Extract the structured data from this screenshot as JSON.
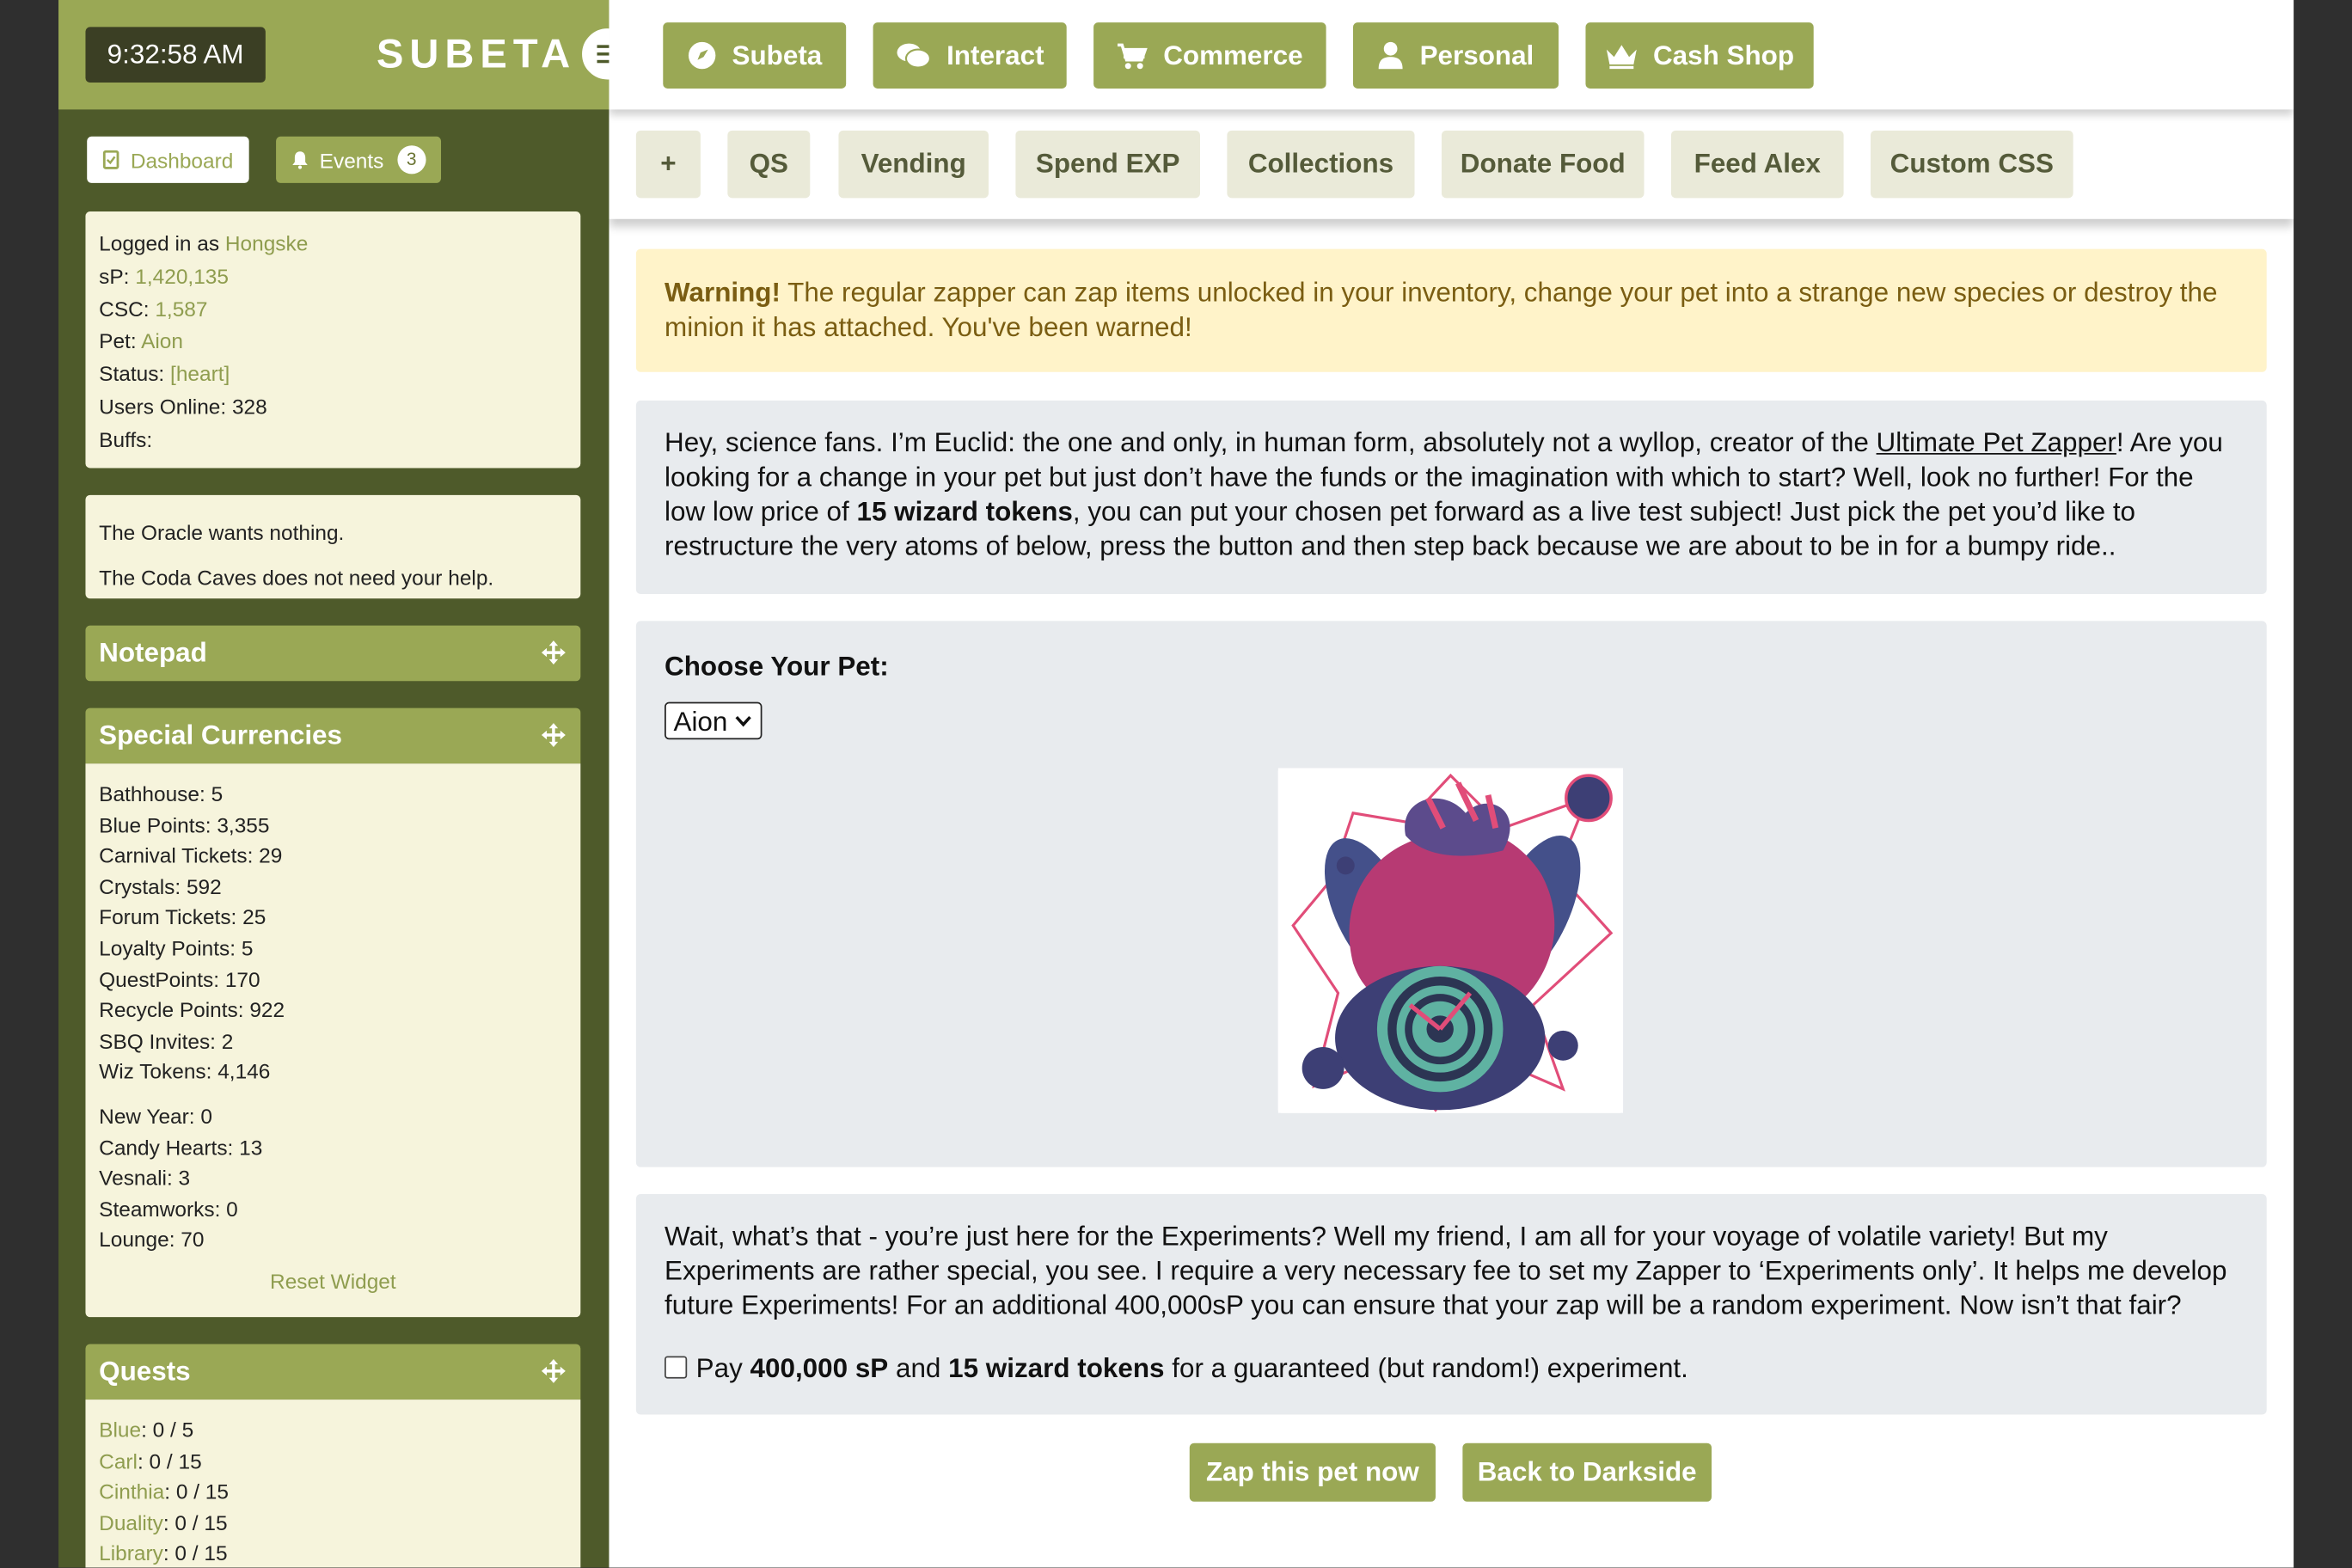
{
  "top": {
    "clock": "9:32:58 AM",
    "logo": "SUBETA",
    "nav": [
      {
        "label": "Subeta",
        "icon": "compass-icon"
      },
      {
        "label": "Interact",
        "icon": "chat-icon"
      },
      {
        "label": "Commerce",
        "icon": "cart-icon"
      },
      {
        "label": "Personal",
        "icon": "user-icon"
      },
      {
        "label": "Cash Shop",
        "icon": "crown-icon"
      }
    ],
    "subnav": [
      "+",
      "QS",
      "Vending",
      "Spend EXP",
      "Collections",
      "Donate Food",
      "Feed Alex",
      "Custom CSS"
    ]
  },
  "sidebar": {
    "dashboard": "Dashboard",
    "events": "Events",
    "events_count": "3",
    "user": {
      "logged_in_label": "Logged in as",
      "username": "Hongske",
      "sp_label": "sP:",
      "sp": "1,420,135",
      "csc_label": "CSC:",
      "csc": "1,587",
      "pet_label": "Pet:",
      "pet": "Aion",
      "status_label": "Status:",
      "status": "[heart]",
      "users_online": "Users Online: 328",
      "buffs": "Buffs:"
    },
    "oracle": [
      "The Oracle wants nothing.",
      "The Coda Caves does not need your help."
    ],
    "notepad_title": "Notepad",
    "currencies_title": "Special Currencies",
    "currencies": [
      "Bathhouse: 5",
      "Blue Points: 3,355",
      "Carnival Tickets: 29",
      "Crystals: 592",
      "Forum Tickets: 25",
      "Loyalty Points: 5",
      "QuestPoints: 170",
      "Recycle Points: 922",
      "SBQ Invites: 2",
      "Wiz Tokens: 4,146"
    ],
    "event_currencies": [
      "New Year: 0",
      "Candy Hearts: 13",
      "Vesnali: 3",
      "Steamworks: 0",
      "Lounge: 70"
    ],
    "reset_widget": "Reset Widget",
    "quests_title": "Quests",
    "quests": [
      {
        "name": "Blue",
        "value": ": 0 / 5"
      },
      {
        "name": "Carl",
        "value": ": 0 / 15"
      },
      {
        "name": "Cinthia",
        "value": ": 0 / 15"
      },
      {
        "name": "Duality",
        "value": ": 0 / 15"
      },
      {
        "name": "Library",
        "value": ": 0 / 15"
      }
    ]
  },
  "main": {
    "warning_strong": "Warning!",
    "warning_text": " The regular zapper can zap items unlocked in your inventory, change your pet into a strange new species or destroy the minion it has attached. You've been warned!",
    "intro_1": "Hey, science fans. I’m Euclid: the one and only, in human form, absolutely not a wyllop, creator of the ",
    "intro_link": "Ultimate Pet Zapper",
    "intro_2": "! Are you looking for a change in your pet but just don’t have the funds or the imagination with which to start? Well, look no further! For the low low price of ",
    "intro_bold": "15 wizard tokens",
    "intro_3": ", you can put your chosen pet forward as a live test subject! Just pick the pet you’d like to restructure the very atoms of below, press the button and then step back because we are about to be in for a bumpy ride..",
    "choose_label": "Choose Your Pet:",
    "selected_pet": "Aion",
    "experiment_text": "Wait, what’s that - you’re just here for the Experiments? Well my friend, I am all for your voyage of volatile variety! But my Experiments are rather special, you see. I require a very necessary fee to set my Zapper to ‘Experiments only’. It helps me develop future Experiments! For an additional 400,000sP you can ensure that your zap will be a random experiment. Now isn’t that fair?",
    "pay_1": "Pay ",
    "pay_bold_1": "400,000 sP",
    "pay_2": " and ",
    "pay_bold_2": "15 wizard tokens",
    "pay_3": " for a guaranteed (but random!) experiment.",
    "zap_button": "Zap this pet now",
    "back_button": "Back to Darkside"
  },
  "colors": {
    "olive": "#9aa855",
    "sidebar": "#4e5a2a",
    "panel": "#f6f4dc",
    "warning_bg": "#fff3c9"
  }
}
